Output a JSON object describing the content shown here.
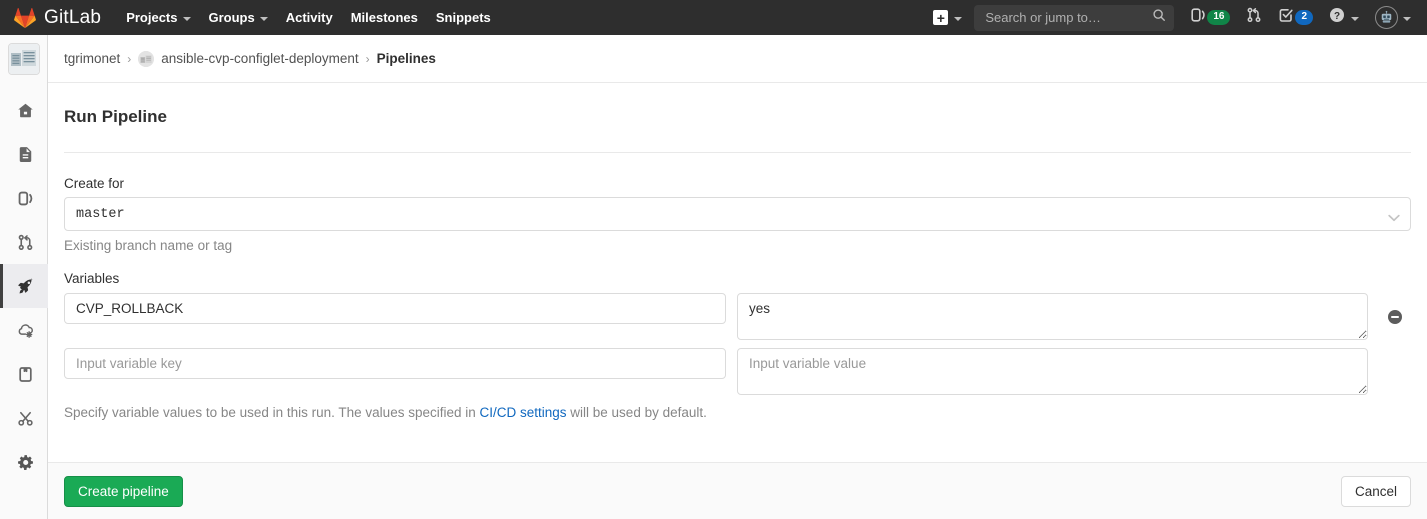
{
  "navbar": {
    "brand": "GitLab",
    "brand_logo_icon": "gitlab-tanuki-logo",
    "items": [
      {
        "label": "Projects",
        "has_caret": true
      },
      {
        "label": "Groups",
        "has_caret": true
      },
      {
        "label": "Activity",
        "has_caret": false
      },
      {
        "label": "Milestones",
        "has_caret": false
      },
      {
        "label": "Snippets",
        "has_caret": false
      }
    ],
    "create_new_icon": "plus-square-icon",
    "create_new_caret_icon": "chevron-down-icon",
    "search": {
      "placeholder": "Search or jump to…",
      "value": "",
      "icon": "search-icon"
    },
    "issues": {
      "icon": "issues-icon",
      "count": "16",
      "badge_color": "#108548"
    },
    "merge_requests": {
      "icon": "merge-request-icon"
    },
    "todos": {
      "icon": "todo-check-icon",
      "count": "2",
      "badge_color": "#1068bf"
    },
    "help": {
      "icon": "question-circle-icon",
      "caret_icon": "chevron-down-icon"
    },
    "user": {
      "icon": "user-avatar-robot",
      "caret_icon": "chevron-down-icon"
    }
  },
  "rail": {
    "project_avatar_icon": "project-avatar-image",
    "items": [
      {
        "icon": "home-icon",
        "name": "project-overview",
        "active": false
      },
      {
        "icon": "document-icon",
        "name": "repository",
        "active": false
      },
      {
        "icon": "issues-icon",
        "name": "issues",
        "active": false
      },
      {
        "icon": "merge-request-icon",
        "name": "merge-requests",
        "active": false
      },
      {
        "icon": "rocket-icon",
        "name": "ci-cd",
        "active": true
      },
      {
        "icon": "cloud-gear-icon",
        "name": "operations",
        "active": false
      },
      {
        "icon": "package-icon",
        "name": "packages",
        "active": false
      },
      {
        "icon": "scissors-icon",
        "name": "snippets",
        "active": false
      },
      {
        "icon": "gear-icon",
        "name": "settings",
        "active": false
      }
    ]
  },
  "breadcrumb": {
    "namespace": "tgrimonet",
    "project": "ansible-cvp-configlet-deployment",
    "project_avatar_icon": "project-avatar-icon",
    "current": "Pipelines",
    "separator": "›"
  },
  "page": {
    "title": "Run Pipeline",
    "create_for": {
      "label": "Create for",
      "value": "master",
      "help": "Existing branch name or tag",
      "chevron_icon": "chevron-down-icon"
    },
    "variables": {
      "label": "Variables",
      "rows": [
        {
          "key": "CVP_ROLLBACK",
          "key_placeholder": "Input variable key",
          "value": "yes",
          "value_placeholder": "Input variable value",
          "removable": true,
          "remove_icon": "minus-circle-icon"
        },
        {
          "key": "",
          "key_placeholder": "Input variable key",
          "value": "",
          "value_placeholder": "Input variable value",
          "removable": false,
          "remove_icon": ""
        }
      ],
      "help_prefix": "Specify variable values to be used in this run. The values specified in ",
      "help_link": "CI/CD settings",
      "help_suffix": " will be used by default."
    },
    "actions": {
      "submit_label": "Create pipeline",
      "cancel_label": "Cancel",
      "submit_color": "#1aaa55"
    }
  }
}
